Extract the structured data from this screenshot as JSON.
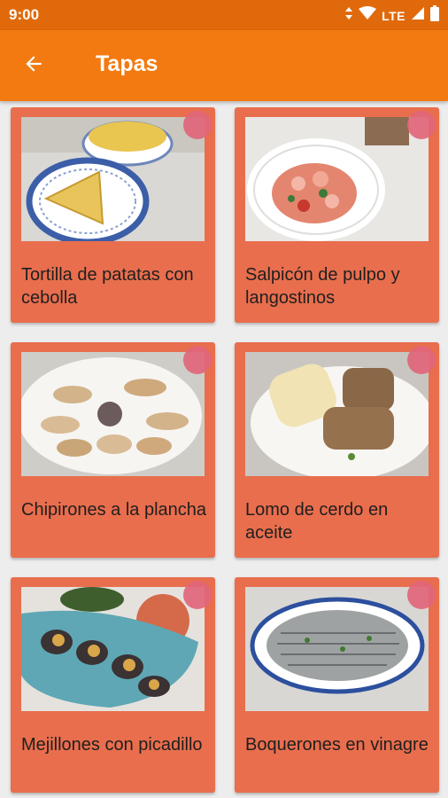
{
  "status_bar": {
    "time": "9:00",
    "network": "LTE"
  },
  "app_bar": {
    "title": "Tapas"
  },
  "recipes": [
    {
      "name": "Tortilla de patatas con cebolla"
    },
    {
      "name": "Salpicón de pulpo y langostinos"
    },
    {
      "name": "Chipirones a la plancha"
    },
    {
      "name": "Lomo de cerdo en aceite"
    },
    {
      "name": "Mejillones con picadillo"
    },
    {
      "name": "Boquerones en vinagre"
    }
  ],
  "colors": {
    "status_bar": "#e06a0b",
    "app_bar": "#f27a10",
    "card": "#e96e4d",
    "favorite_marker": "#e0667a",
    "background": "#ededed"
  }
}
